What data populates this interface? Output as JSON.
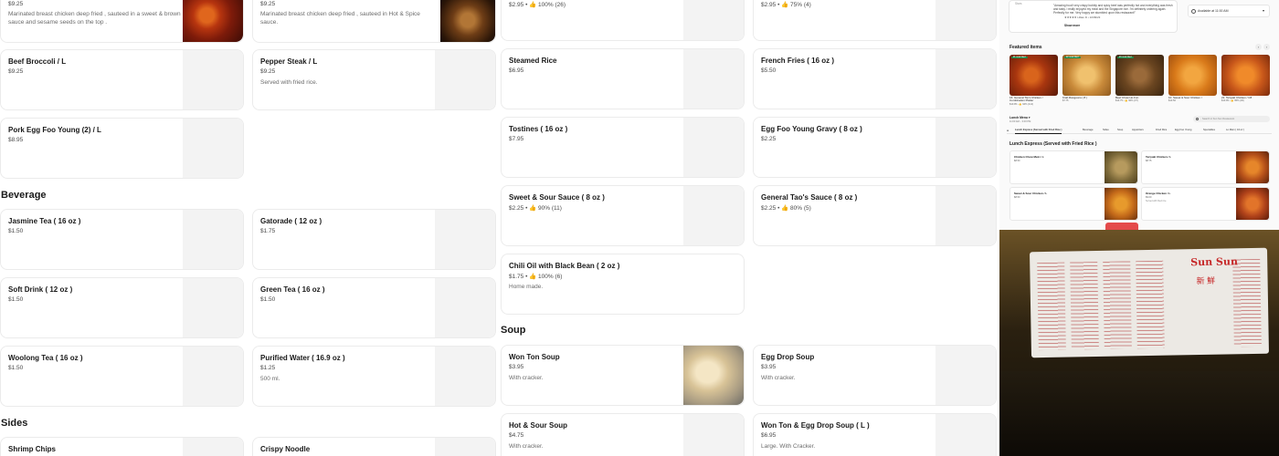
{
  "menu": {
    "top_row": [
      {
        "price": "$9.25",
        "desc": "Marinated breast chicken deep fried , sauteed in a sweet & brown sauce and sesame seeds on the top ."
      },
      {
        "price": "$9.25",
        "desc": "Marinated breast chicken deep fried , sauteed in Hot & Spice sauce."
      },
      {
        "meta": "$2.95 • 👍 100% (26)"
      },
      {
        "meta": "$2.95 • 👍 75% (4)"
      }
    ],
    "col1_items": [
      {
        "name": "Beef Broccoli / L",
        "price": "$9.25"
      },
      {
        "name": "Pork Egg Foo Young (2) / L",
        "price": "$8.95"
      }
    ],
    "col2_items": [
      {
        "name": "Pepper Steak / L",
        "price": "$9.25",
        "desc": "Served with fried rice."
      }
    ],
    "col3_items": [
      {
        "name": "Steamed Rice",
        "price": "$6.95"
      },
      {
        "name": "Tostines ( 16 oz )",
        "price": "$7.95"
      },
      {
        "name": "Sweet & Sour Sauce ( 8 oz )",
        "price": "$2.25 • 👍 90% (11)"
      },
      {
        "name": "Chili Oil with Black Bean ( 2 oz  )",
        "price": "$1.75 • 👍 100% (6)",
        "desc": "Home made."
      }
    ],
    "col4_items": [
      {
        "name": "French Fries ( 16 oz )",
        "price": "$5.50"
      },
      {
        "name": "Egg Foo Young Gravy ( 8 oz )",
        "price": "$2.25"
      },
      {
        "name": "General Tao's Sauce ( 8 oz )",
        "price": "$2.25 • 👍 80% (5)"
      }
    ],
    "beverage": {
      "title": "Beverage",
      "items": [
        {
          "name": "Jasmine Tea ( 16 oz )",
          "price": "$1.50"
        },
        {
          "name": "Gatorade  ( 12 oz )",
          "price": "$1.75"
        },
        {
          "name": "Soft Drink ( 12 oz )",
          "price": "$1.50"
        },
        {
          "name": "Green Tea ( 16 oz )",
          "price": "$1.50"
        },
        {
          "name": "Woolong Tea ( 16 oz )",
          "price": "$1.50"
        },
        {
          "name": "Purified Water ( 16.9 oz )",
          "price": "$1.25",
          "desc": "500 ml."
        }
      ]
    },
    "soup": {
      "title": "Soup",
      "items": [
        {
          "name": "Won Ton Soup",
          "price": "$3.95",
          "desc": "With cracker."
        },
        {
          "name": "Egg Drop Soup",
          "price": "$3.95",
          "desc": "With cracker."
        },
        {
          "name": "Hot & Sour Soup",
          "price": "$4.75",
          "desc": "With cracker."
        },
        {
          "name": "Won Ton & Egg Drop Soup ( L )",
          "price": "$6.95",
          "desc": "Large. With Cracker."
        }
      ]
    },
    "sides": {
      "title": "Sides",
      "items": [
        {
          "name": "Shrimp Chips"
        },
        {
          "name": "Crispy Noodle"
        }
      ]
    }
  },
  "panel": {
    "review_small": "Stars",
    "review_text": "\"Amazing food! very crispy bubbly and spicy beef was perfectly hot and everything was fresh and tasty. I really enjoyed my meal and the Singapore rice. I'm definitely ordering again. Perfectly for me. Very happy we stumbled upon this restaurant!\"",
    "review_stars": "★★★★★  Lillian D  •  10/09/23",
    "see_more": "Show more",
    "available": "Available at 11:00 AM",
    "featured_title": "Featured items",
    "featured": [
      {
        "tag": "#1 most liked",
        "name": "16. General Tso's Chicken / Combination Platter",
        "price": "$10.95 • 👍 94% (112)"
      },
      {
        "tag": "#2 most liked",
        "name": "Krab Rangoons ( 8 )",
        "price": "$7.75"
      },
      {
        "tag": "#3 most liked",
        "name": "Beef Chow Ho Fun",
        "price": "$14.75 • 👍 96% (37)"
      },
      {
        "tag": "",
        "name": "10. Sweet & Sour Chicken / ",
        "price": "$13.50"
      },
      {
        "tag": "",
        "name": "21. Teriyaki Chicken / C8",
        "price": "$13.95 • 👍 95% (30)"
      }
    ],
    "lunch_label": "Lunch Menu ▾",
    "lunch_hours": "11:00 AM – 3:00 PM",
    "search_placeholder": "Search in Sun Sun Restaurant",
    "tabs": [
      "Lunch Express (Served with Fried Rice )",
      "Beverage",
      "Sides",
      "Soup",
      "Appetizers",
      "Fried Rice",
      "Egg Foo Young",
      "Specialties",
      "Lo Mein ( 16 oz )"
    ],
    "lunch_section": "Lunch Express (Served with Fried Rice )",
    "lunch_items": [
      {
        "name": "Chicken Chow Mein / L",
        "price": "$8.50",
        "desc": ""
      },
      {
        "name": "Teriyaki Chicken / L",
        "price": "$8.75",
        "desc": ""
      },
      {
        "name": "Sweet & Sour Chicken / L",
        "price": "$8.50",
        "desc": ""
      },
      {
        "name": "Orange Chicken / L",
        "price": "$9.00",
        "desc": "Served with fried rice."
      }
    ],
    "photo_logo": "Sun Sun",
    "photo_glyph": "新 鮮"
  }
}
